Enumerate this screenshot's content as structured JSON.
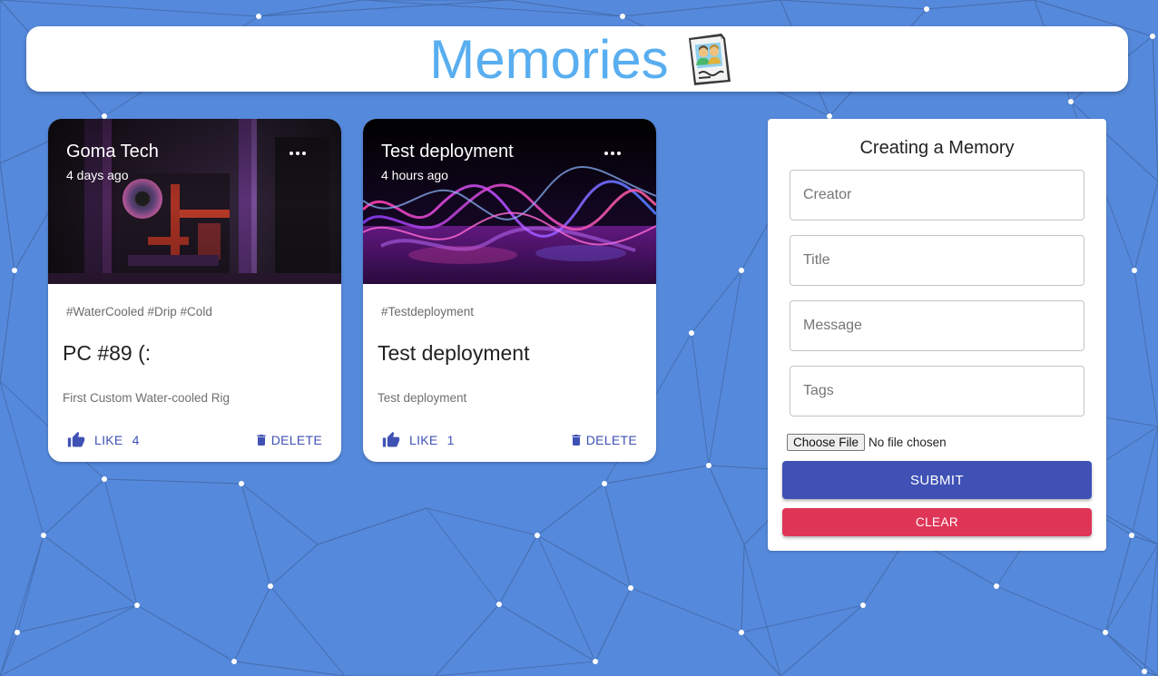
{
  "app": {
    "title": "Memories",
    "logo_icon": "memories-photo-icon"
  },
  "posts": [
    {
      "creator": "Goma Tech",
      "time": "4 days ago",
      "tags": "#WaterCooled #Drip #Cold",
      "title": "PC #89 (:",
      "message": "First Custom Water-cooled Rig",
      "like_label": "LIKE",
      "like_count": "4",
      "delete_label": "DELETE",
      "image": "pc-build-photo"
    },
    {
      "creator": "Test deployment",
      "time": "4 hours ago",
      "tags": "#Testdeployment",
      "title": "Test deployment",
      "message": "Test deployment",
      "like_label": "LIKE",
      "like_count": "1",
      "delete_label": "DELETE",
      "image": "neon-waves-photo"
    }
  ],
  "form": {
    "title": "Creating a Memory",
    "creator_placeholder": "Creator",
    "title_placeholder": "Title",
    "message_placeholder": "Message",
    "tags_placeholder": "Tags",
    "file_button": "Choose File",
    "file_status": "No file chosen",
    "submit_label": "SUBMIT",
    "clear_label": "CLEAR"
  },
  "colors": {
    "background": "#5589db",
    "brand_title": "#59aef0",
    "primary": "#3f51b5",
    "secondary": "#df3557"
  }
}
